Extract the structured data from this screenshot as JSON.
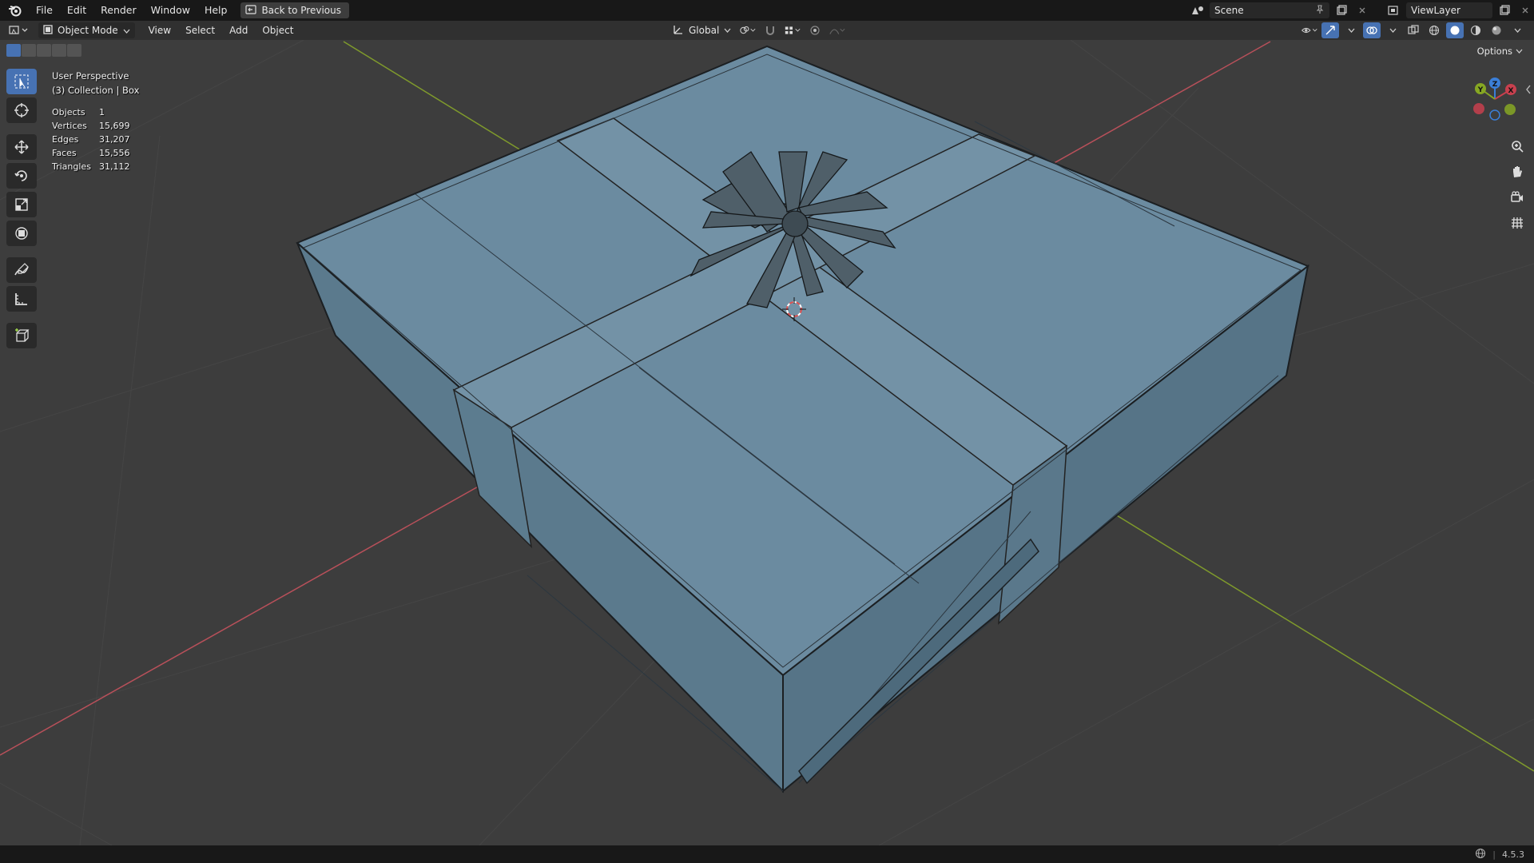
{
  "menubar": {
    "items": [
      "File",
      "Edit",
      "Render",
      "Window",
      "Help"
    ],
    "back_button": "Back to Previous",
    "scene_name": "Scene",
    "view_layer": "ViewLayer"
  },
  "view_header": {
    "mode": "Object Mode",
    "menus": [
      "View",
      "Select",
      "Add",
      "Object"
    ],
    "orientation": "Global"
  },
  "viewport": {
    "perspective": "User Perspective",
    "collection": "(3) Collection | Box",
    "stats": [
      {
        "label": "Objects",
        "value": "1"
      },
      {
        "label": "Vertices",
        "value": "15,699"
      },
      {
        "label": "Edges",
        "value": "31,207"
      },
      {
        "label": "Faces",
        "value": "15,556"
      },
      {
        "label": "Triangles",
        "value": "31,112"
      }
    ],
    "options_label": "Options",
    "gizmo_axes": {
      "x": "X",
      "y": "Y",
      "z": "Z"
    }
  },
  "toolbar": {
    "tools": [
      "select-box-icon",
      "cursor-icon",
      "move-icon",
      "rotate-icon",
      "scale-icon",
      "transform-icon",
      "annotate-icon",
      "measure-icon",
      "add-cube-icon"
    ]
  },
  "statusbar": {
    "version": "4.5.3"
  },
  "colors": {
    "accent": "#4772b3",
    "axis_x": "#c8404e",
    "axis_y": "#86a723",
    "axis_z": "#3b7fd8",
    "mesh_face": "#6e8ea3"
  }
}
